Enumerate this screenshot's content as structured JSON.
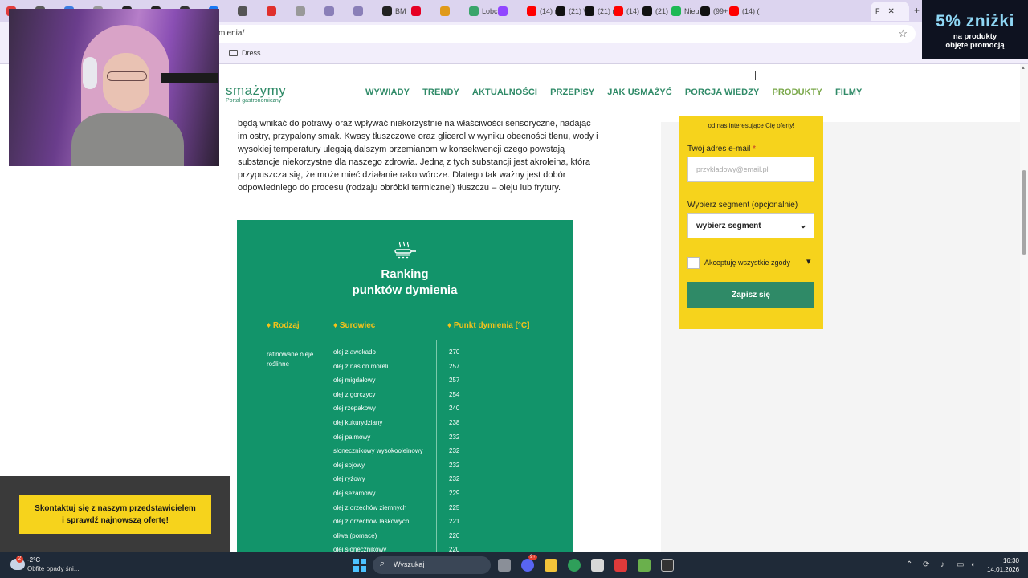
{
  "browser": {
    "tabs": [
      {
        "label": "",
        "color": "#e23b3b"
      },
      {
        "label": "",
        "color": "#5a5a5a"
      },
      {
        "label": "",
        "color": "#3b7de2"
      },
      {
        "label": "",
        "color": "#999999"
      },
      {
        "label": "",
        "color": "#222222"
      },
      {
        "label": "",
        "color": "#222222"
      },
      {
        "label": "",
        "color": "#333333"
      },
      {
        "label": "",
        "color": "#1877f2"
      },
      {
        "label": "",
        "color": "#555555"
      },
      {
        "label": "",
        "color": "#e0302c"
      },
      {
        "label": "",
        "color": "#999999"
      },
      {
        "label": "",
        "color": "#8a7fb8"
      },
      {
        "label": "",
        "color": "#8a7fb8"
      },
      {
        "label": "BM",
        "color": "#222222"
      },
      {
        "label": "",
        "color": "#e60023"
      },
      {
        "label": "",
        "color": "#e09a1a"
      },
      {
        "label": "Lobc",
        "color": "#3aa56b"
      },
      {
        "label": "",
        "color": "#9146ff"
      },
      {
        "label": "(14) (",
        "color": "#ff0000"
      },
      {
        "label": "(21) \\",
        "color": "#111111"
      },
      {
        "label": "(21) (",
        "color": "#111111"
      },
      {
        "label": "(14) (",
        "color": "#ff0000"
      },
      {
        "label": "(21) (",
        "color": "#111111"
      },
      {
        "label": "Nieu",
        "color": "#1db954"
      },
      {
        "label": "(99+",
        "color": "#111111"
      },
      {
        "label": "(14) (",
        "color": "#ff0000"
      }
    ],
    "active_tab_label": "F",
    "close_label": "✕",
    "new_tab_label": "+",
    "url": "mienia/",
    "bookmark_folder": "Dress"
  },
  "ad": {
    "big": "5% zniżki",
    "line1": "na produkty",
    "line2": "objęte promocją"
  },
  "site": {
    "logo_main": "smażymy",
    "logo_sub": "Portal gastronomiczny",
    "nav": [
      "WYWIADY",
      "TRENDY",
      "AKTUALNOŚCI",
      "PRZEPISY",
      "JAK USMAŻYĆ",
      "PORCJA WIEDZY",
      "PRODUKTY",
      "FILMY"
    ],
    "nav_active_index": 6
  },
  "article": {
    "text": "będą wnikać do potrawy oraz wpływać niekorzystnie na właściwości sensoryczne, nadając im ostry, przypalony smak. Kwasy tłuszczowe oraz glicerol w wyniku obecności tlenu, wody i wysokiej temperatury ulegają dalszym przemianom w konsekwencji czego powstają substancje niekorzystne dla naszego zdrowia. Jedną z tych substancji jest akroleina, która przypuszcza się, że może mieć działanie rakotwórcze. Dlatego tak ważny jest dobór odpowiedniego do procesu (rodzaju obróbki termicznej) tłuszczu – oleju lub frytury."
  },
  "infographic": {
    "title_line1": "Ranking",
    "title_line2": "punktów dymienia",
    "col_type": "♦ Rodzaj",
    "col_raw": "♦ Surowiec",
    "col_point": "♦ Punkt dymienia [°C]",
    "category": "rafinowane oleje roślinne",
    "rows": [
      {
        "name": "olej z awokado",
        "temp": "270"
      },
      {
        "name": "olej z nasion moreli",
        "temp": "257"
      },
      {
        "name": "olej migdałowy",
        "temp": "257"
      },
      {
        "name": "olej z gorczycy",
        "temp": "254"
      },
      {
        "name": "olej rzepakowy",
        "temp": "240"
      },
      {
        "name": "olej kukurydziany",
        "temp": "238"
      },
      {
        "name": "olej palmowy",
        "temp": "232"
      },
      {
        "name": "słonecznikowy wysokooleinowy",
        "temp": "232"
      },
      {
        "name": "olej sojowy",
        "temp": "232"
      },
      {
        "name": "olej ryżowy",
        "temp": "232"
      },
      {
        "name": "olej sezamowy",
        "temp": "229"
      },
      {
        "name": "olej z orzechów ziemnych",
        "temp": "225"
      },
      {
        "name": "olej z orzechów laskowych",
        "temp": "221"
      },
      {
        "name": "oliwa (pomace)",
        "temp": "220"
      },
      {
        "name": "olej słonecznikowy",
        "temp": "220"
      }
    ]
  },
  "newsletter": {
    "top_text": "od nas interesujące Cię oferty!",
    "email_label": "Twój adres e-mail",
    "required_mark": "*",
    "email_placeholder": "przykładowy@email.pl",
    "segment_label": "Wybierz segment (opcjonalnie)",
    "segment_value": "wybierz segment",
    "consent_label": "Akceptuję wszystkie zgody",
    "subscribe_label": "Zapisz się"
  },
  "contact": {
    "line1": "Skontaktuj się z naszym przedstawicielem",
    "line2": "i sprawdź najnowszą ofertę!"
  },
  "taskbar": {
    "weather_badge": "2",
    "weather_temp": "-2°C",
    "weather_desc": "Obfite opady śni...",
    "search_label": "Wyszukaj",
    "time": "16:30",
    "date": "14.01.2026",
    "notification_badge": "9+"
  },
  "colors": {
    "brand_green": "#2f8a67",
    "infographic_green": "#12946a",
    "accent_yellow": "#f6d31c",
    "nav_active": "#7aa84a"
  }
}
